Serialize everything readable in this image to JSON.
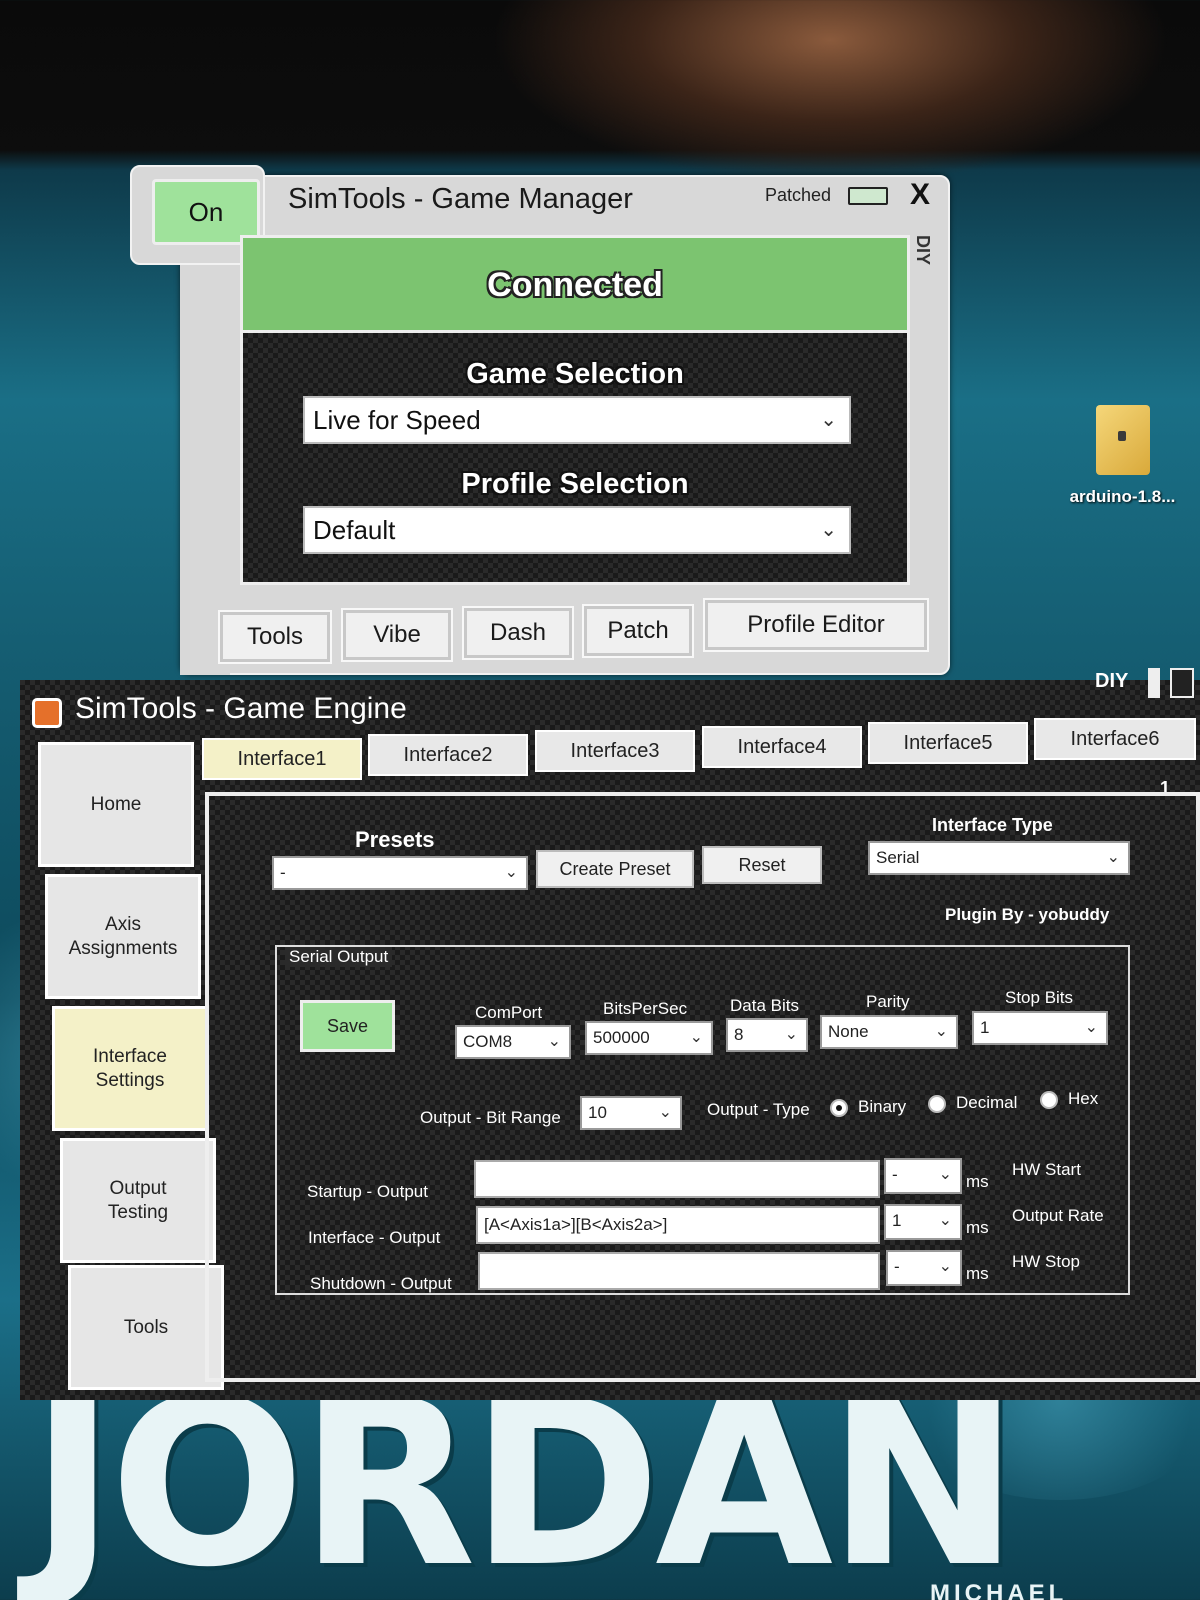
{
  "desktop": {
    "icon_label": "arduino-1.8...",
    "wallpaper_text": "JORDAN",
    "wallpaper_subtext": "MICHAEL"
  },
  "game_manager": {
    "on_button": "On",
    "title": "SimTools - Game Manager",
    "patched_label": "Patched",
    "close": "X",
    "side_label": "DIY",
    "status": "Connected",
    "game_selection_label": "Game Selection",
    "game_selection_value": "Live for Speed",
    "profile_selection_label": "Profile Selection",
    "profile_selection_value": "Default",
    "buttons": [
      "Tools",
      "Vibe",
      "Dash",
      "Patch",
      "Profile Editor"
    ]
  },
  "game_engine": {
    "title": "SimTools - Game Engine",
    "diy_label": "DIY",
    "sidebar": [
      "Home",
      "Axis\nAssignments",
      "Interface\nSettings",
      "Output\nTesting",
      "Tools"
    ],
    "active_sidebar": "Interface Settings",
    "tabs": [
      "Interface1",
      "Interface2",
      "Interface3",
      "Interface4",
      "Interface5",
      "Interface6"
    ],
    "active_tab": "Interface1",
    "page_marker": "1",
    "presets_label": "Presets",
    "presets_value": "-",
    "create_preset": "Create Preset",
    "reset": "Reset",
    "interface_type_label": "Interface Type",
    "interface_type_value": "Serial",
    "plugin_by": "Plugin By - yobuddy",
    "serial_output_legend": "Serial Output",
    "save": "Save",
    "comport_label": "ComPort",
    "comport_value": "COM8",
    "bits_per_sec_label": "BitsPerSec",
    "bits_per_sec_value": "500000",
    "data_bits_label": "Data Bits",
    "data_bits_value": "8",
    "parity_label": "Parity",
    "parity_value": "None",
    "stop_bits_label": "Stop Bits",
    "stop_bits_value": "1",
    "bit_range_label": "Output - Bit Range",
    "bit_range_value": "10",
    "output_type_label": "Output - Type",
    "output_types": [
      "Binary",
      "Decimal",
      "Hex"
    ],
    "output_type_selected": "Binary",
    "startup_label": "Startup - Output",
    "startup_value": "",
    "startup_ms_value": "-",
    "interface_label": "Interface - Output",
    "interface_value": "[A<Axis1a>][B<Axis2a>]",
    "interface_ms_value": "1",
    "shutdown_label": "Shutdown - Output",
    "shutdown_value": "",
    "shutdown_ms_value": "-",
    "ms_unit": "ms",
    "hw_start": "HW Start",
    "output_rate": "Output Rate",
    "hw_stop": "HW Stop"
  }
}
